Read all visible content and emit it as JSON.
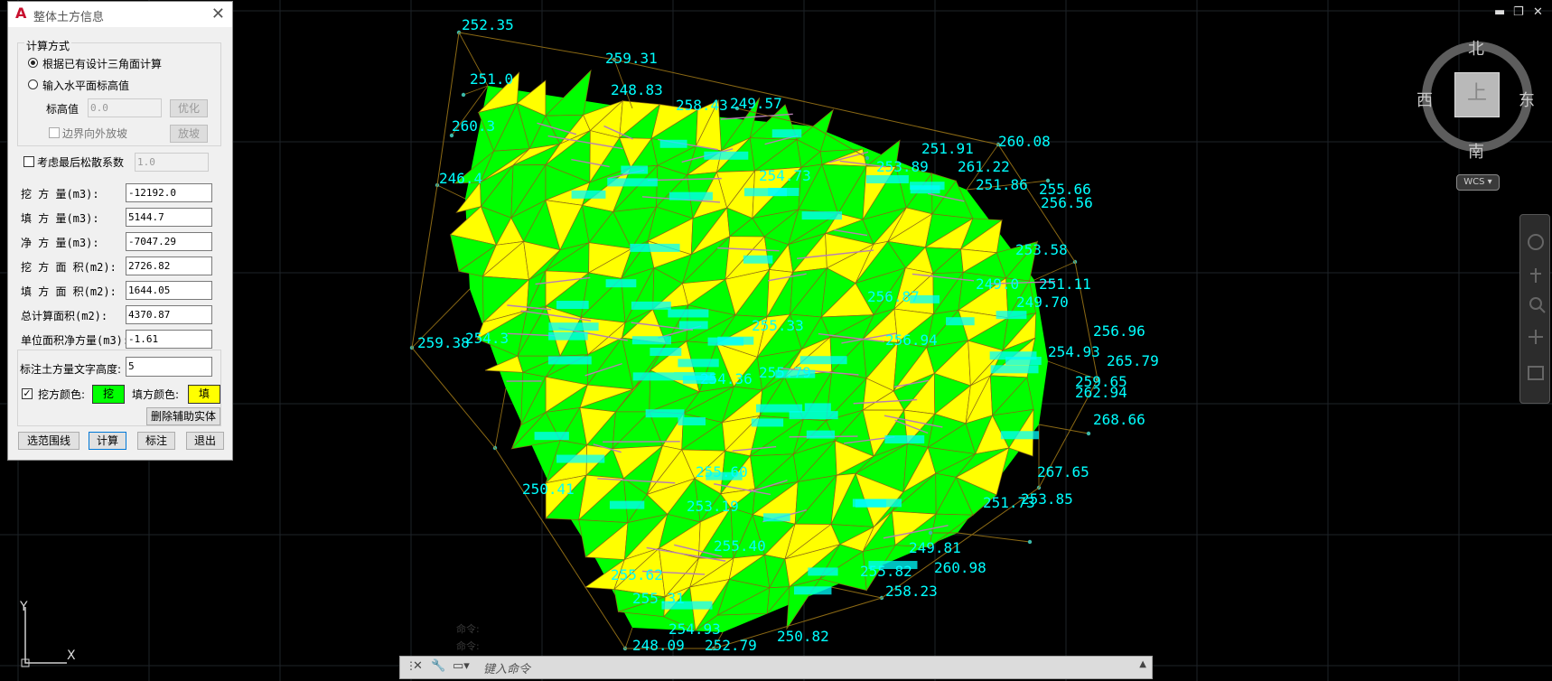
{
  "dialog": {
    "title": "整体土方信息",
    "close": "✕",
    "calc_mode_label": "计算方式",
    "mode1_label": "根据已有设计三角面计算",
    "mode2_label": "输入水平面标高值",
    "elev_label": "标高值",
    "elev_value": "0.0",
    "optimize_btn": "优化",
    "boundary_label": "边界向外放坡",
    "slope_btn": "放坡",
    "loose_label": "考虑最后松散系数",
    "loose_value": "1.0",
    "results": [
      {
        "label": "挖  方  量(m3):",
        "value": "-12192.0"
      },
      {
        "label": "填  方  量(m3):",
        "value": "5144.7"
      },
      {
        "label": "净  方  量(m3):",
        "value": "-7047.29"
      },
      {
        "label": "挖 方 面 积(m2):",
        "value": "2726.82"
      },
      {
        "label": "填 方 面 积(m2):",
        "value": "1644.05"
      },
      {
        "label": "总计算面积(m2):",
        "value": "4370.87"
      },
      {
        "label": "单位面积净方量(m3):",
        "value": "-1.61"
      }
    ],
    "text_height_label": "标注土方量文字高度:",
    "text_height_value": "5",
    "cut_color_label": "挖方颜色:",
    "cut_color_btn": "挖",
    "fill_color_label": "填方颜色:",
    "fill_color_btn": "填",
    "delete_btn": "删除辅助实体",
    "select_btn": "选范围线",
    "calc_btn": "计算",
    "mark_btn": "标注",
    "exit_btn": "退出",
    "cut_color": "#00ff00",
    "fill_color": "#ffff00"
  },
  "compass": {
    "north": "北",
    "south": "南",
    "west": "西",
    "east": "东",
    "top": "上",
    "wcs": "WCS ▾"
  },
  "window_controls": {
    "minimize": "▬",
    "restore": "❐",
    "close": "✕"
  },
  "ucs": {
    "y": "Y",
    "x": "X"
  },
  "command": {
    "placeholder": "键入命令",
    "history1": "命令:",
    "history2": "命令:"
  },
  "elevation_labels": [
    "252.35",
    "259.31",
    "251.0",
    "248.83",
    "258.43",
    "249.57",
    "260.08",
    "251.91",
    "261.22",
    "246.4",
    "253.89",
    "251.86",
    "255.66",
    "260.3",
    "256.56",
    "253.58",
    "249.0",
    "251.11",
    "259.38",
    "249.70",
    "254.3",
    "255.33",
    "256.87",
    "256.94",
    "256.96",
    "268.66",
    "267.65",
    "253.85",
    "251.73",
    "250.41",
    "255.62",
    "255.31",
    "248.09",
    "254.93",
    "250.82",
    "255.82",
    "260.98",
    "258.23",
    "249.81",
    "255.60",
    "255.79",
    "254.36",
    "254.73",
    "265.79",
    "262.94",
    "259.65",
    "254.93",
    "253.19",
    "255.40",
    "252.79"
  ],
  "colors": {
    "cut": "#00ff00",
    "fill": "#ffff00",
    "edge": "#8b6914",
    "label": "#00ffff",
    "hatch": "#b77fb5"
  }
}
